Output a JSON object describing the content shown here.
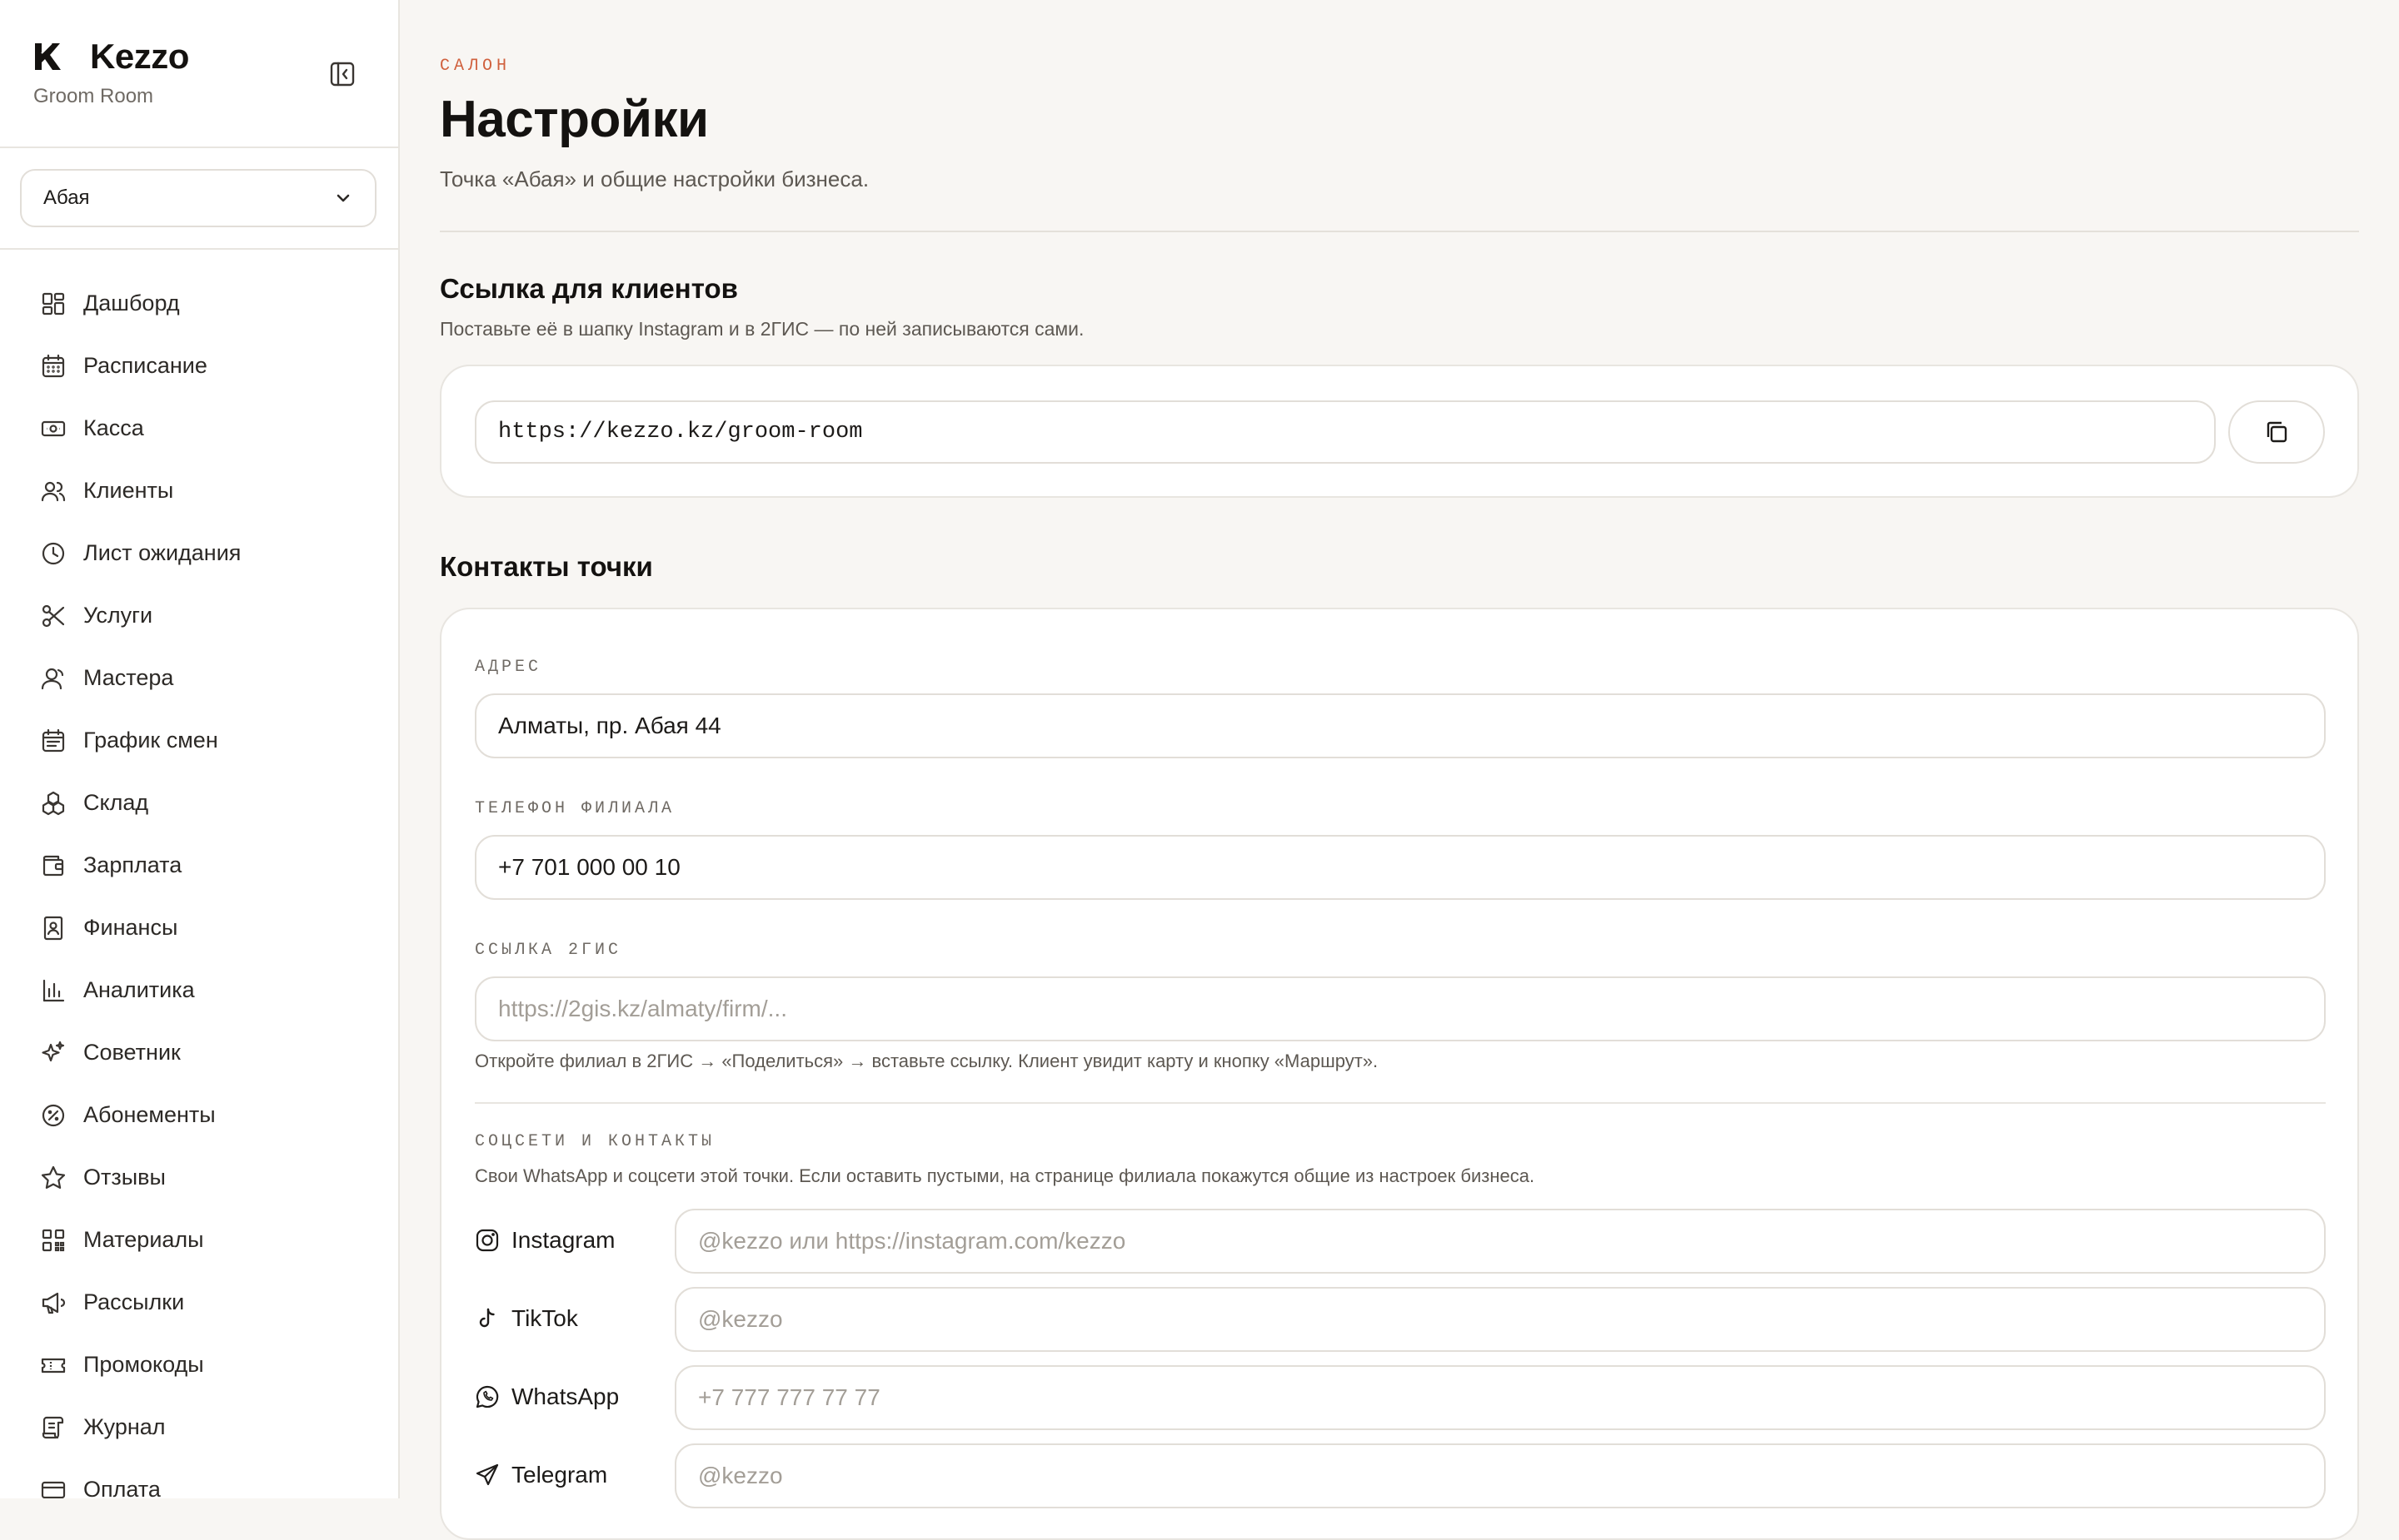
{
  "brand": {
    "name": "Kezzo",
    "business": "Groom Room"
  },
  "branch_select": {
    "value": "Абая"
  },
  "nav": [
    {
      "label": "Дашборд",
      "icon": "dashboard-icon"
    },
    {
      "label": "Расписание",
      "icon": "calendar-icon"
    },
    {
      "label": "Касса",
      "icon": "cash-icon"
    },
    {
      "label": "Клиенты",
      "icon": "users-icon"
    },
    {
      "label": "Лист ожидания",
      "icon": "clock-icon"
    },
    {
      "label": "Услуги",
      "icon": "scissors-icon"
    },
    {
      "label": "Мастера",
      "icon": "staff-icon"
    },
    {
      "label": "График смен",
      "icon": "calendar-grid-icon"
    },
    {
      "label": "Склад",
      "icon": "boxes-icon"
    },
    {
      "label": "Зарплата",
      "icon": "wallet-icon"
    },
    {
      "label": "Финансы",
      "icon": "ledger-icon"
    },
    {
      "label": "Аналитика",
      "icon": "bar-chart-icon"
    },
    {
      "label": "Советник",
      "icon": "sparkles-icon"
    },
    {
      "label": "Абонементы",
      "icon": "badge-percent-icon"
    },
    {
      "label": "Отзывы",
      "icon": "star-icon"
    },
    {
      "label": "Материалы",
      "icon": "qr-icon"
    },
    {
      "label": "Рассылки",
      "icon": "megaphone-icon"
    },
    {
      "label": "Промокоды",
      "icon": "ticket-icon"
    },
    {
      "label": "Журнал",
      "icon": "scroll-icon"
    },
    {
      "label": "Оплата",
      "icon": "card-icon"
    }
  ],
  "header": {
    "eyebrow": "САЛОН",
    "title": "Настройки",
    "description": "Точка «Абая» и общие настройки бизнеса."
  },
  "client_link": {
    "title": "Ссылка для клиентов",
    "description": "Поставьте её в шапку Instagram и в 2ГИС — по ней записываются сами.",
    "url": "https://kezzo.kz/groom-room"
  },
  "contacts": {
    "title": "Контакты точки",
    "address_label": "АДРЕС",
    "address_value": "Алматы, пр. Абая 44",
    "phone_label": "ТЕЛЕФОН ФИЛИАЛА",
    "phone_value": "+7 701 000 00 10",
    "gis_label": "ССЫЛКА 2ГИС",
    "gis_placeholder": "https://2gis.kz/almaty/firm/...",
    "gis_hint": "Откройте филиал в 2ГИС → «Поделиться» → вставьте ссылку. Клиент увидит карту и кнопку «Маршрут».",
    "social_label": "СОЦСЕТИ И КОНТАКТЫ",
    "social_hint": "Свои WhatsApp и соцсети этой точки. Если оставить пустыми, на странице филиала покажутся общие из настроек бизнеса.",
    "socials": [
      {
        "label": "Instagram",
        "placeholder": "@kezzo или https://instagram.com/kezzo",
        "icon": "instagram-icon"
      },
      {
        "label": "TikTok",
        "placeholder": "@kezzo",
        "icon": "tiktok-icon"
      },
      {
        "label": "WhatsApp",
        "placeholder": "+7 777 777 77 77",
        "icon": "whatsapp-icon"
      },
      {
        "label": "Telegram",
        "placeholder": "@kezzo",
        "icon": "telegram-icon"
      }
    ]
  }
}
